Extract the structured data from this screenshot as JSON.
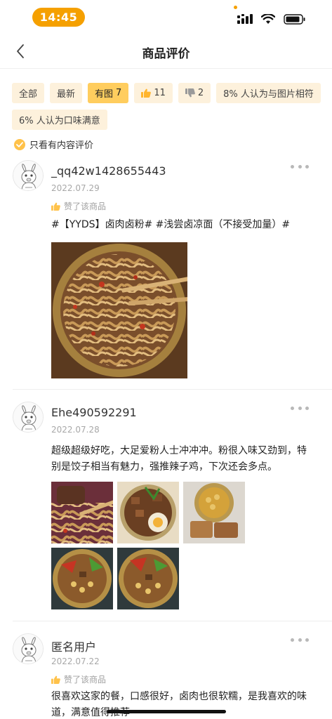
{
  "status_bar": {
    "time": "14:45",
    "accent": "#f5a000"
  },
  "nav": {
    "title": "商品评价",
    "back_icon": "chevron-left-icon"
  },
  "filters": [
    {
      "label": "全部",
      "count": "",
      "icon": "",
      "active": false
    },
    {
      "label": "最新",
      "count": "",
      "icon": "",
      "active": false
    },
    {
      "label": "有图",
      "count": "7",
      "icon": "",
      "active": true
    },
    {
      "label": "",
      "count": "11",
      "icon": "thumbs-up-icon",
      "active": false
    },
    {
      "label": "",
      "count": "2",
      "icon": "thumbs-down-icon",
      "active": false
    },
    {
      "label": "8% 人认为与图片相符",
      "count": "",
      "icon": "",
      "active": false
    },
    {
      "label": "6% 人认为口味满意",
      "count": "",
      "icon": "",
      "active": false
    }
  ],
  "only_content": {
    "label": "只看有内容评价",
    "checked": true
  },
  "reviews": [
    {
      "user": "_qq42w1428655443",
      "date": "2022.07.29",
      "liked_label": "赞了该商品",
      "text": "#【YYDS】卤肉卤粉# #浅尝卤凉面（不接受加量）#",
      "photos": [
        "noodle-bowl-photo"
      ]
    },
    {
      "user": "Ehe490592291",
      "date": "2022.07.28",
      "liked_label": "",
      "text": "超级超级好吃，大足爱粉人士冲冲冲。粉很入味又劲到，特别是饺子相当有魅力，强推辣子鸡，下次还会多点。",
      "photos": [
        "noodle-photo",
        "braised-meat-egg-photo",
        "tofu-meat-photo",
        "spicy-chicken-photo",
        "spicy-chicken-photo-2"
      ]
    },
    {
      "user": "匿名用户",
      "date": "2022.07.22",
      "liked_label": "赞了该商品",
      "text": "很喜欢这家的餐，口感很好，卤肉也很软糯，是我喜欢的味道，满意值得推荐",
      "photos": []
    }
  ],
  "colors": {
    "tag_bg": "#fdf1dc",
    "tag_active": "#ffcd5e",
    "like_icon": "#ffc24a"
  }
}
